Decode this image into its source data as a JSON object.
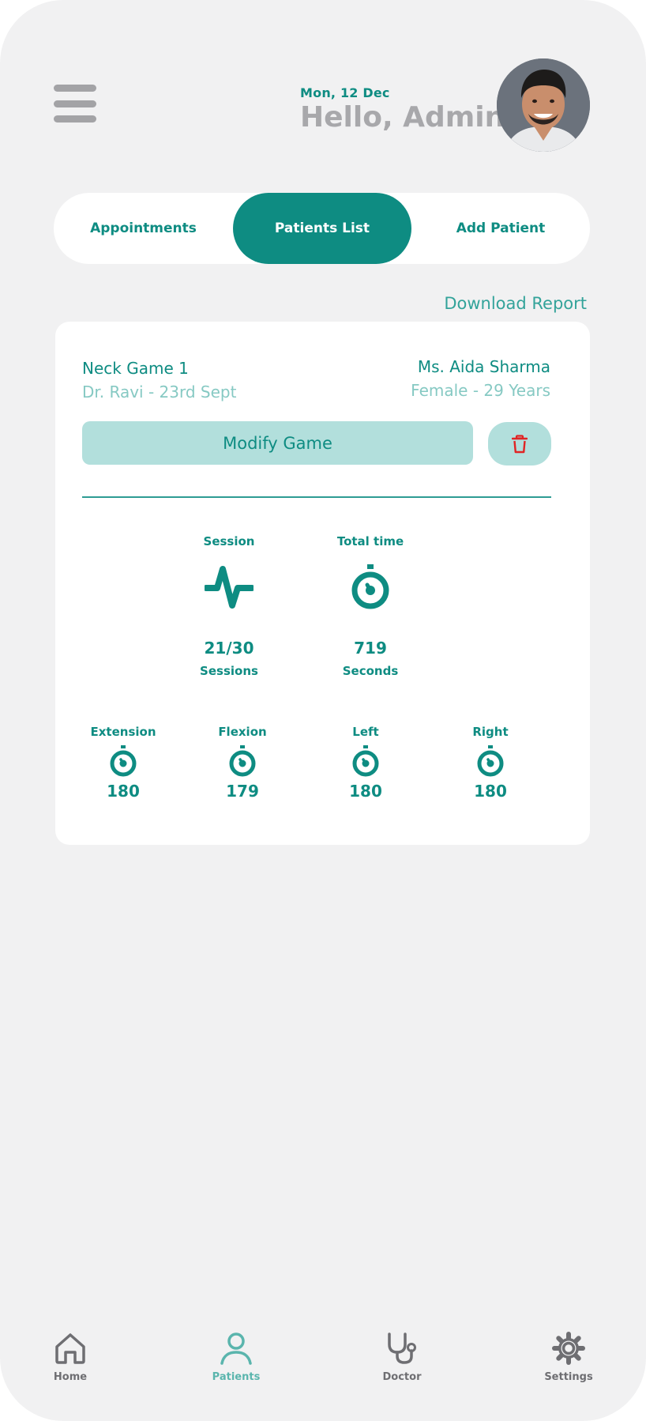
{
  "header": {
    "date": "Mon, 12 Dec",
    "greeting": "Hello, Admin"
  },
  "tabs": [
    {
      "label": "Appointments",
      "active": false
    },
    {
      "label": "Patients List",
      "active": true
    },
    {
      "label": "Add Patient",
      "active": false
    }
  ],
  "download_report": "Download Report",
  "card": {
    "game_name": "Neck Game 1",
    "doctor_date": "Dr. Ravi - 23rd Sept",
    "patient_name": "Ms. Aida Sharma",
    "patient_info": "Female - 29 Years",
    "modify_label": "Modify Game",
    "session": {
      "label": "Session",
      "value": "21/30",
      "unit": "Sessions"
    },
    "total_time": {
      "label": "Total time",
      "value": "719",
      "unit": "Seconds"
    },
    "motions": [
      {
        "label": "Extension",
        "value": "180"
      },
      {
        "label": "Flexion",
        "value": "179"
      },
      {
        "label": "Left",
        "value": "180"
      },
      {
        "label": "Right",
        "value": "180"
      }
    ]
  },
  "nav": [
    {
      "label": "Home",
      "icon": "home-icon"
    },
    {
      "label": "Patients",
      "icon": "user-icon",
      "active": true
    },
    {
      "label": "Doctor",
      "icon": "stethoscope-icon"
    },
    {
      "label": "Settings",
      "icon": "gear-icon"
    }
  ],
  "colors": {
    "accent": "#0e8c82",
    "accent_light": "#b2dfdc",
    "muted_teal": "#86c9c3",
    "background": "#f1f1f2",
    "delete_icon": "#e02424"
  }
}
